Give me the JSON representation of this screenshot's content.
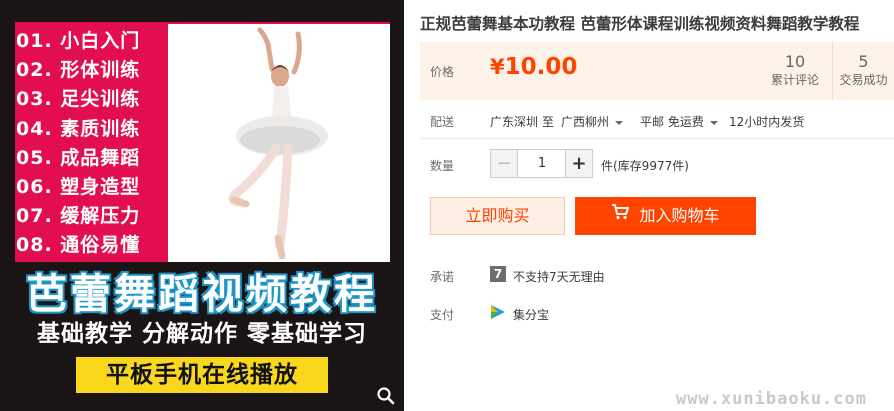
{
  "promo": {
    "list": [
      "01. 小白入门",
      "02. 形体训练",
      "03. 足尖训练",
      "04. 素质训练",
      "05. 成品舞蹈",
      "06. 塑身造型",
      "07. 缓解压力",
      "08. 通俗易懂"
    ],
    "title": "芭蕾舞蹈视频教程",
    "subtitle": "基础教学 分解动作 零基础学习",
    "badge": "平板手机在线播放"
  },
  "product": {
    "title": "正规芭蕾舞基本功教程 芭蕾形体课程训练视频资料舞蹈教学教程"
  },
  "price_panel": {
    "label": "价格",
    "currency": "¥",
    "value": "10.00",
    "reviews_count": "10",
    "reviews_label": "累计评论",
    "deals_count": "5",
    "deals_label": "交易成功"
  },
  "delivery": {
    "label": "配送",
    "from": "广东深圳",
    "to_word": "至",
    "destination": "广西柳州",
    "shipping": "平邮 免运费",
    "dispatch": "12小时内发货"
  },
  "quantity": {
    "label": "数量",
    "minus": "−",
    "value": "1",
    "plus": "+",
    "stock_text": "件(库存9977件)"
  },
  "actions": {
    "buy_now": "立即购买",
    "add_to_cart": "加入购物车"
  },
  "promise": {
    "label": "承诺",
    "icon_glyph": "7",
    "text": "不支持7天无理由"
  },
  "payment": {
    "label": "支付",
    "method": "集分宝"
  },
  "watermark": "www.xunibaoku.com",
  "colors": {
    "accent": "#ff4400",
    "price_bg": "#fef3e8",
    "promo_pink": "#e30e4f",
    "badge_yellow": "#f9d71c"
  }
}
